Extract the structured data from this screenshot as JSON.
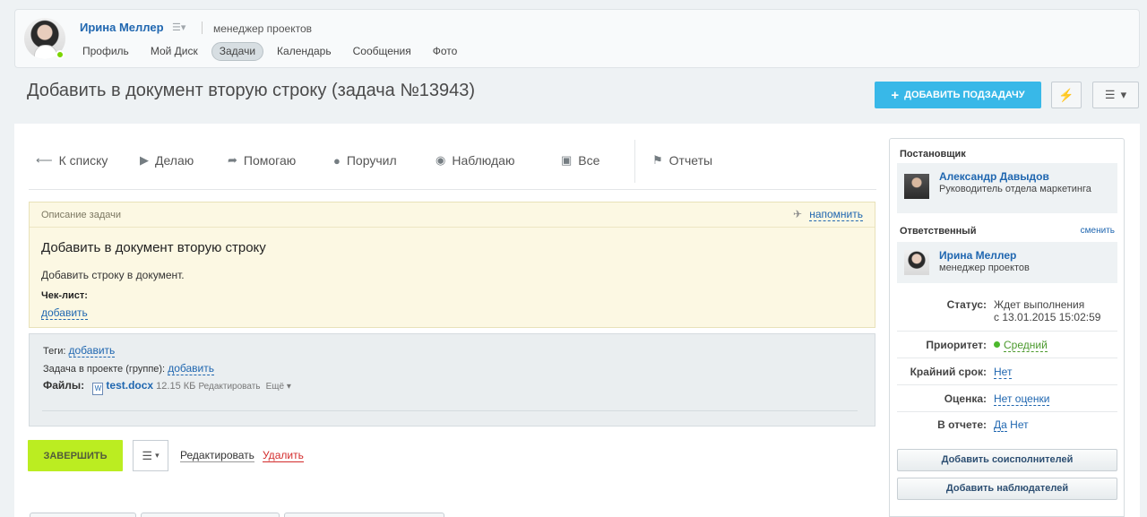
{
  "profile": {
    "name": "Ирина Меллер",
    "role": "менеджер проектов",
    "tabs": [
      "Профиль",
      "Мой Диск",
      "Задачи",
      "Календарь",
      "Сообщения",
      "Фото"
    ]
  },
  "title": "Добавить в документ вторую строку (задача №13943)",
  "header_actions": {
    "add_subtask_label": "ДОБАВИТЬ ПОДЗАДАЧУ"
  },
  "filter_bar": {
    "back": "К списку",
    "doing": "Делаю",
    "helping": "Помогаю",
    "assigned": "Поручил",
    "watching": "Наблюдаю",
    "all": "Все",
    "reports": "Отчеты"
  },
  "description": {
    "label": "Описание задачи",
    "remind": "напомнить",
    "title": "Добавить в документ вторую строку",
    "text": "Добавить строку в документ.",
    "checklist_label": "Чек-лист:",
    "checklist_add": "добавить"
  },
  "meta": {
    "tags_label": "Теги:",
    "tags_add": "добавить",
    "project_label": "Задача в проекте (группе):",
    "project_add": "добавить",
    "files_label": "Файлы:",
    "file_name": "test.docx",
    "file_size": "12.15 КБ",
    "file_edit": "Редактировать",
    "file_more": "Ещё"
  },
  "actions": {
    "finish": "ЗАВЕРШИТЬ",
    "edit": "Редактировать",
    "delete": "Удалить"
  },
  "sidebar": {
    "creator_label": "Постановщик",
    "creator_name": "Александр Давыдов",
    "creator_role": "Руководитель отдела маркетинга",
    "responsible_label": "Ответственный",
    "change": "сменить",
    "responsible_name": "Ирина Меллер",
    "responsible_role": "менеджер проектов",
    "status_label": "Статус:",
    "status_value": "Ждет выполнения",
    "status_since": "с 13.01.2015 15:02:59",
    "priority_label": "Приоритет:",
    "priority_value": "Средний",
    "deadline_label": "Крайний срок:",
    "deadline_value": "Нет",
    "rating_label": "Оценка:",
    "rating_value": "Нет оценки",
    "report_label": "В отчете:",
    "report_yes": "Да",
    "report_no": "Нет",
    "add_coexecutors": "Добавить соисполнителей",
    "add_watchers": "Добавить наблюдателей"
  },
  "colors": {
    "accent_blue": "#38b8e8",
    "link_blue": "#2067b0",
    "finish_green": "#bbed21",
    "delete_red": "#d32c2c"
  }
}
